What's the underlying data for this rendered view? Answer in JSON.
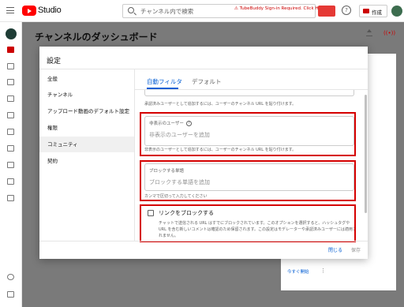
{
  "app": {
    "brand": "Studio",
    "search_placeholder": "チャンネル内で検索",
    "extension_warning": "⚠ TubeBuddy Sign-in Required. Click Here",
    "help_glyph": "?",
    "create_label": "作成",
    "page_title": "チャンネルのダッシュボード"
  },
  "modal": {
    "title": "設定",
    "nav": [
      {
        "label": "全般"
      },
      {
        "label": "チャンネル"
      },
      {
        "label": "アップロード動画のデフォルト設定"
      },
      {
        "label": "権限"
      },
      {
        "label": "コミュニティ",
        "active": true
      },
      {
        "label": "契約"
      }
    ],
    "tabs": [
      {
        "label": "自動フィルタ",
        "active": true
      },
      {
        "label": "デフォルト"
      }
    ],
    "help_glyph": "?",
    "approved_users_help": "承認済みユーザーとして追加するには、ユーザーのチャンネル URL を貼り付けます。",
    "hidden_users": {
      "label": "非表示のユーザー",
      "placeholder": "非表示のユーザーを追加",
      "help": "非表示のユーザーとして追加するには、ユーザーのチャンネル URL を貼り付けます。"
    },
    "blocked_words": {
      "label": "ブロックする単語",
      "placeholder": "ブロックする単語を追加",
      "help": "カンマで区切って入力してください"
    },
    "block_links": {
      "label": "リンクをブロックする",
      "checked": false,
      "desc_line1": "チャットで送信される URL はすでにブロックされています。このオプションを選択すると、ハッシュタグや",
      "desc_line2": "URL を含む新しいコメントは確認のため保留されます。この設定はモデレーターや承認済みユーザーには適用さ",
      "desc_line3": "れません。"
    },
    "close_label": "閉じる",
    "save_label": "保存"
  },
  "background": {
    "card_text": "今すぐ開始",
    "dots": "⋮"
  },
  "colors": {
    "accent_blue": "#065fd4",
    "highlight_red": "#d50000",
    "brand_red": "#ff0000"
  }
}
